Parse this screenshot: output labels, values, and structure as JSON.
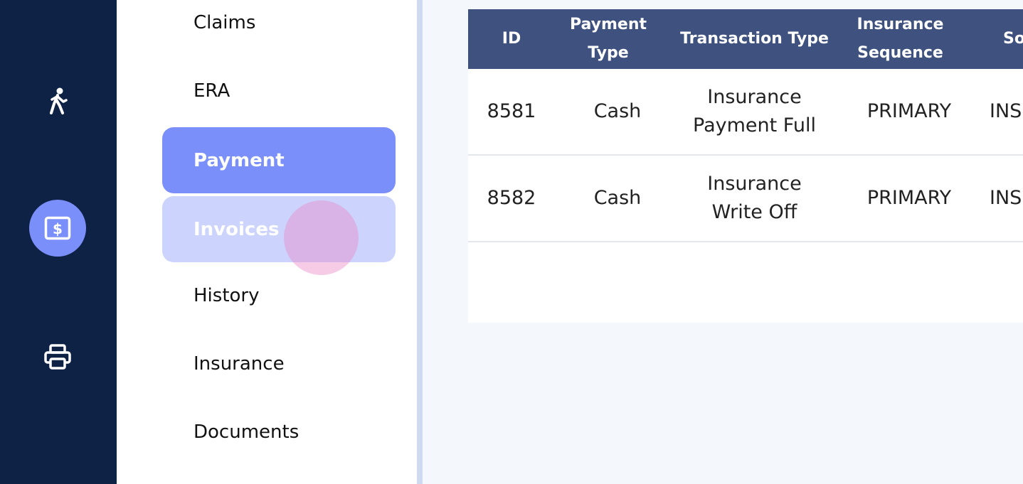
{
  "rail": {
    "icons": [
      {
        "name": "walking-person-icon"
      },
      {
        "name": "dollar-bill-icon",
        "active": true
      },
      {
        "name": "printer-icon"
      }
    ]
  },
  "submenu": {
    "items": [
      {
        "label": "Claims"
      },
      {
        "label": "ERA"
      },
      {
        "label": "Payment",
        "state": "active"
      },
      {
        "label": "Invoices",
        "state": "hovered"
      },
      {
        "label": "History"
      },
      {
        "label": "Insurance"
      },
      {
        "label": "Documents"
      }
    ]
  },
  "table": {
    "columns": [
      "ID",
      "Payment Type",
      "Transaction Type",
      "Insurance Sequence",
      "So"
    ],
    "rows": [
      {
        "id": "8581",
        "payment_type": "Cash",
        "transaction_type": "Insurance Payment Full",
        "sequence": "PRIMARY",
        "source": "INSU"
      },
      {
        "id": "8582",
        "payment_type": "Cash",
        "transaction_type": "Insurance Write Off",
        "sequence": "PRIMARY",
        "source": "INSU"
      }
    ]
  },
  "colors": {
    "rail_bg": "#0e2245",
    "accent": "#7a8ff9",
    "accent_light": "#ccd4fd",
    "table_header_bg": "#3e517f",
    "page_bg": "#f4f7fc"
  }
}
